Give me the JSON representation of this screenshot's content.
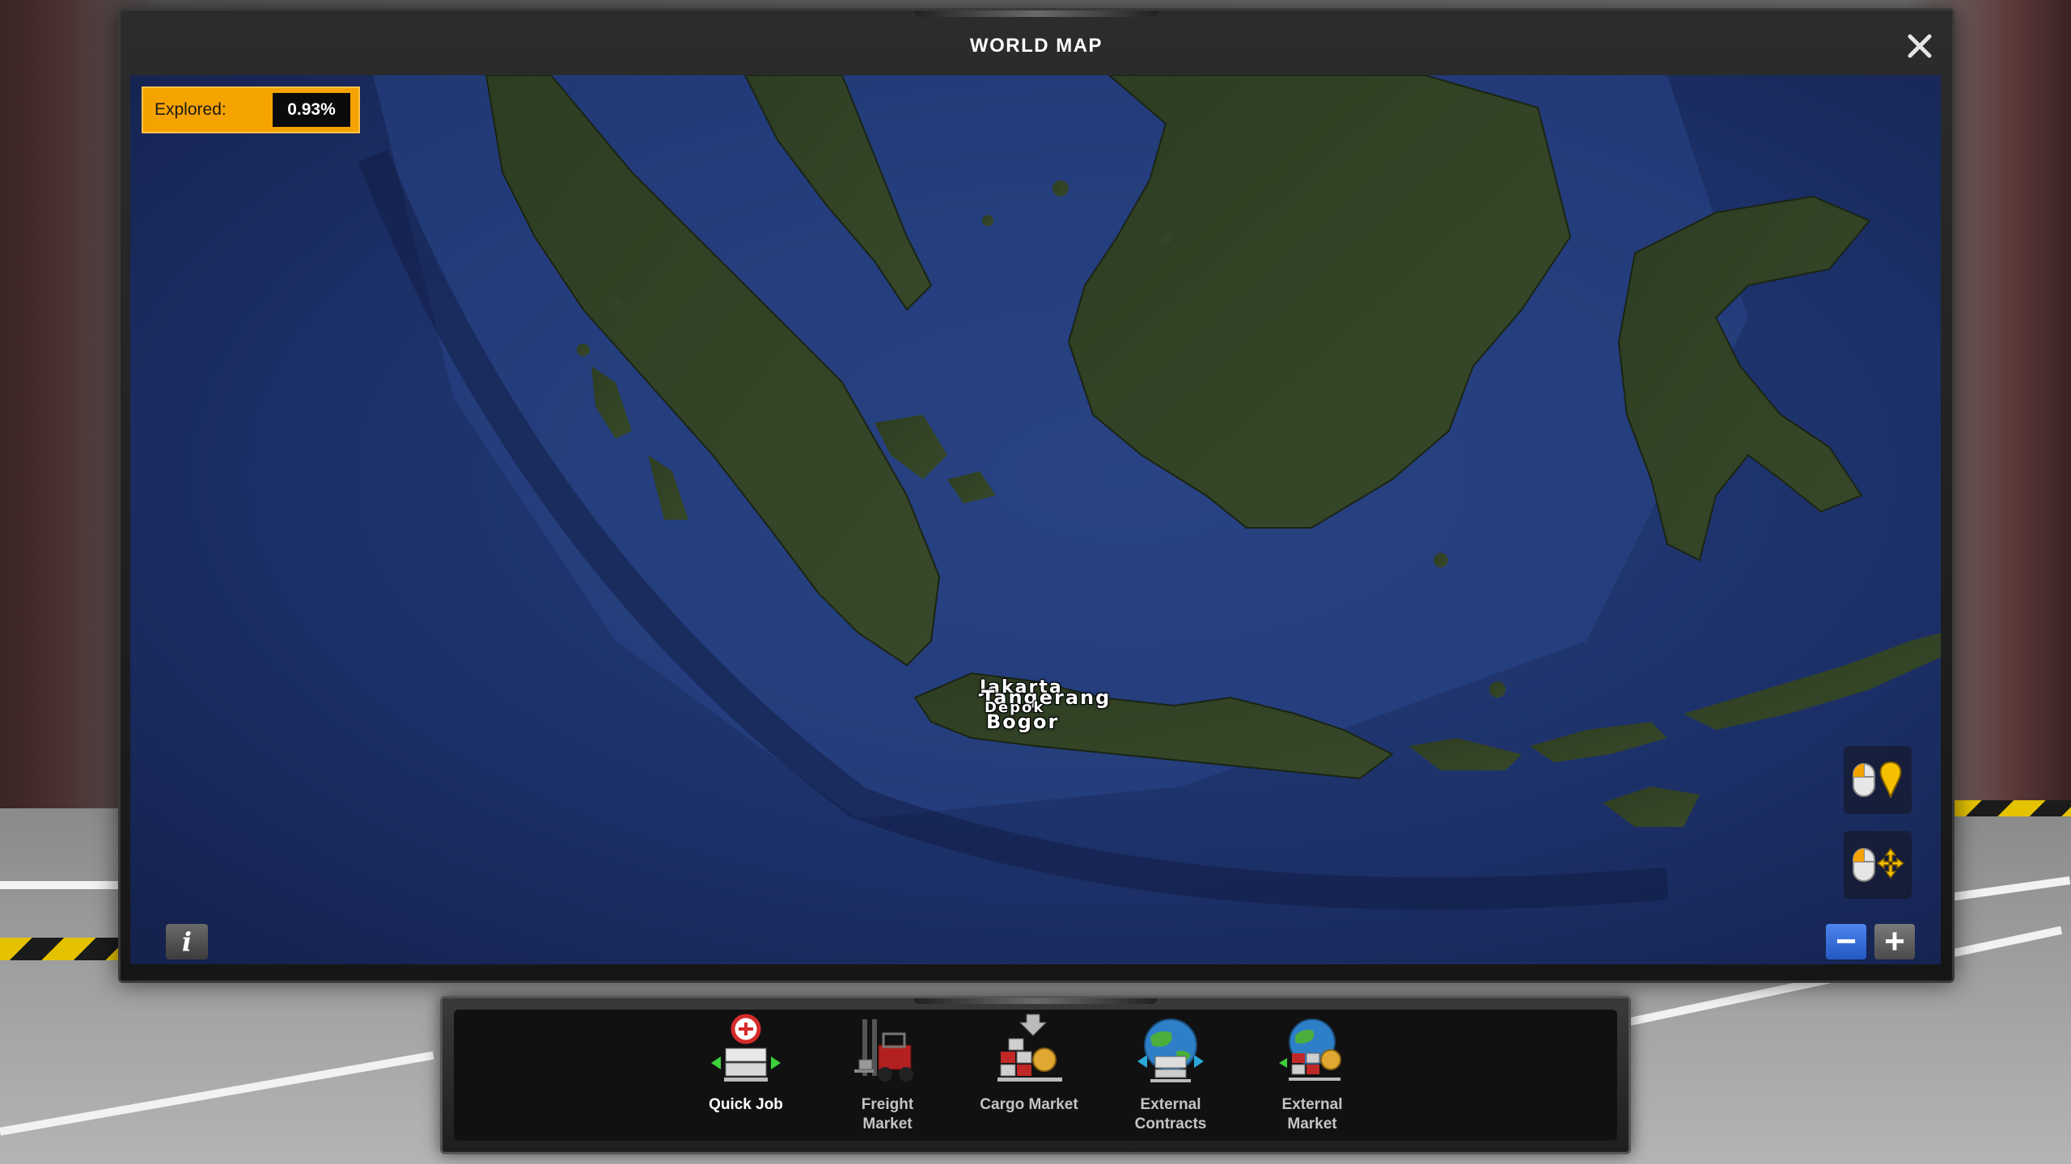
{
  "window": {
    "title": "WORLD MAP",
    "close_icon": "close-icon"
  },
  "explored": {
    "label": "Explored:",
    "value": "0.93%"
  },
  "map": {
    "cities": [
      "Jakarta",
      "Tangerang",
      "Depok",
      "Bogor"
    ]
  },
  "controls": {
    "info_icon": "info-icon",
    "info_glyph": "i",
    "mouse_marker_icon": "mouse-marker-icon",
    "mouse_pan_icon": "mouse-pan-icon",
    "zoom_out_glyph": "−",
    "zoom_in_glyph": "+",
    "zoom_out_color": "#2f6de0"
  },
  "dock": {
    "items": [
      {
        "label": "Quick Job",
        "icon": "quick-job-icon",
        "active": true
      },
      {
        "label": "Freight Market",
        "icon": "freight-market-icon",
        "active": false
      },
      {
        "label": "Cargo Market",
        "icon": "cargo-market-icon",
        "active": false
      },
      {
        "label": "External Contracts",
        "icon": "external-contracts-icon",
        "active": false
      },
      {
        "label": "External Market",
        "icon": "external-market-icon",
        "active": false
      }
    ]
  },
  "colors": {
    "accent": "#f5a300",
    "ocean": "#1d3270",
    "land": "#2f3f24"
  }
}
